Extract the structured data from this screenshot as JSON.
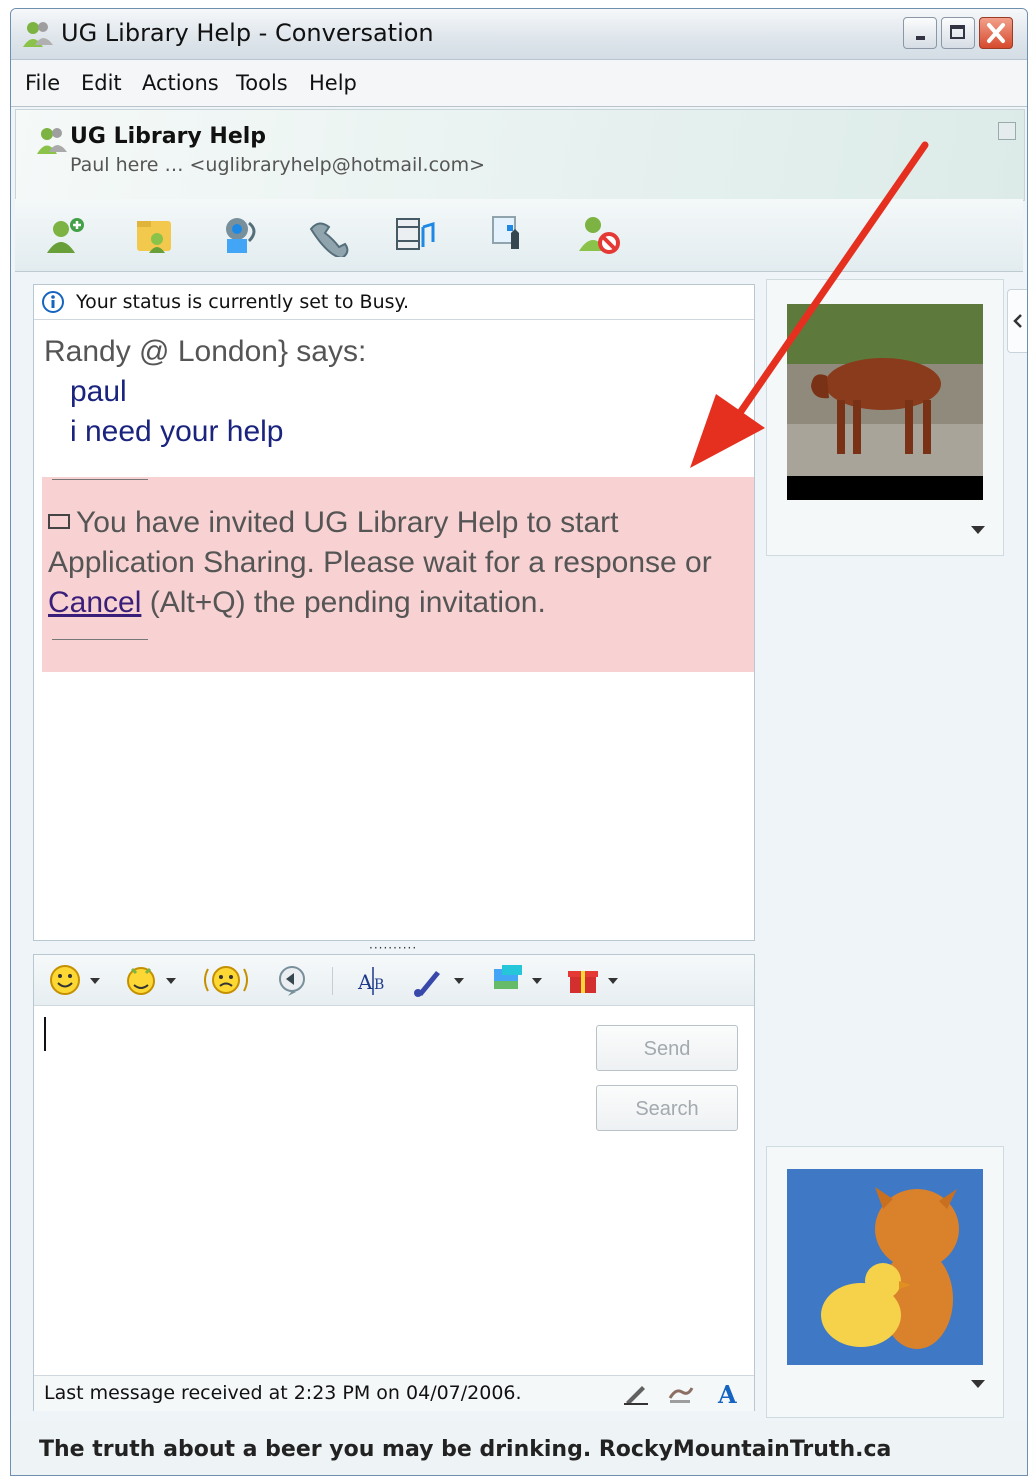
{
  "window": {
    "title": "UG  Library Help - Conversation"
  },
  "menu": [
    "File",
    "Edit",
    "Actions",
    "Tools",
    "Help"
  ],
  "contact": {
    "name": "UG  Library Help",
    "status": "Paul here …  <uglibraryhelp@hotmail.com>"
  },
  "toolbar": {
    "icons": [
      "invite-contact-icon",
      "send-files-icon",
      "webcam-icon",
      "call-icon",
      "activities-icon",
      "games-icon",
      "block-icon"
    ]
  },
  "chat": {
    "status_notice": "Your status is currently set to Busy.",
    "sender": "Randy @ London} says:",
    "lines": [
      "paul",
      "i need your help"
    ],
    "invitation": {
      "text_before": "You have invited UG  Library Help to start Application Sharing. Please wait for a response or",
      "cancel_link": "Cancel",
      "text_after": "(Alt+Q) the pending invitation."
    }
  },
  "compose": {
    "send_label": "Send",
    "search_label": "Search",
    "last_message": "Last message received at 2:23 PM on 04/07/2006."
  },
  "ad": {
    "text": "The truth about a beer you may be drinking. RockyMountainTruth.ca"
  },
  "colors": {
    "invite_background": "#f8d2d2",
    "annotation_arrow": "#e53020",
    "message_text": "#1a237e"
  }
}
